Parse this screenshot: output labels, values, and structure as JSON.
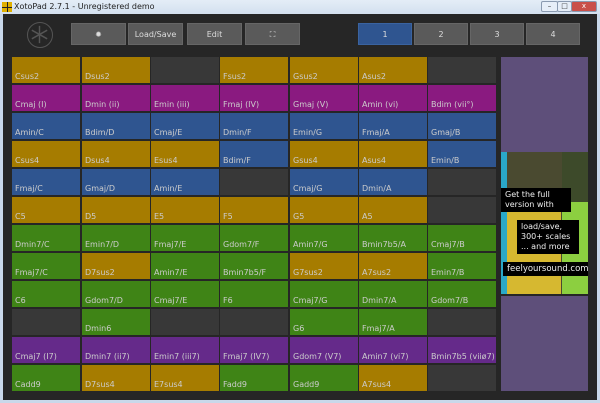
{
  "window": {
    "title": "XotoPad 2.7.1 - Unregistered demo"
  },
  "toolbar": {
    "settings_icon": "gear-icon",
    "load_save": "Load/Save",
    "edit": "Edit",
    "fullscreen_icon": "fullscreen-icon"
  },
  "pages": {
    "items": [
      "1",
      "2",
      "3",
      "4"
    ],
    "active": "1"
  },
  "colors": {
    "Y": "#a67c00",
    "M": "#8a1a80",
    "B": "#2f5590",
    "G": "#3f8416",
    "P": "#652a8a",
    "E": "#383838"
  },
  "grid": [
    [
      [
        "Csus2",
        "Y"
      ],
      [
        "Dsus2",
        "Y"
      ],
      [
        "",
        "E"
      ],
      [
        "Fsus2",
        "Y"
      ],
      [
        "Gsus2",
        "Y"
      ],
      [
        "Asus2",
        "Y"
      ],
      [
        "",
        "E"
      ]
    ],
    [
      [
        "Cmaj (I)",
        "M"
      ],
      [
        "Dmin (ii)",
        "M"
      ],
      [
        "Emin (iii)",
        "M"
      ],
      [
        "Fmaj (IV)",
        "M"
      ],
      [
        "Gmaj (V)",
        "M"
      ],
      [
        "Amin (vi)",
        "M"
      ],
      [
        "Bdim (vii°)",
        "M"
      ]
    ],
    [
      [
        "Amin/C",
        "B"
      ],
      [
        "Bdim/D",
        "B"
      ],
      [
        "Cmaj/E",
        "B"
      ],
      [
        "Dmin/F",
        "B"
      ],
      [
        "Emin/G",
        "B"
      ],
      [
        "Fmaj/A",
        "B"
      ],
      [
        "Gmaj/B",
        "B"
      ]
    ],
    [
      [
        "Csus4",
        "Y"
      ],
      [
        "Dsus4",
        "Y"
      ],
      [
        "Esus4",
        "Y"
      ],
      [
        "Bdim/F",
        "B"
      ],
      [
        "Gsus4",
        "Y"
      ],
      [
        "Asus4",
        "Y"
      ],
      [
        "Emin/B",
        "B"
      ]
    ],
    [
      [
        "Fmaj/C",
        "B"
      ],
      [
        "Gmaj/D",
        "B"
      ],
      [
        "Amin/E",
        "B"
      ],
      [
        "",
        "E"
      ],
      [
        "Cmaj/G",
        "B"
      ],
      [
        "Dmin/A",
        "B"
      ],
      [
        "",
        "E"
      ]
    ],
    [
      [
        "C5",
        "Y"
      ],
      [
        "D5",
        "Y"
      ],
      [
        "E5",
        "Y"
      ],
      [
        "F5",
        "Y"
      ],
      [
        "G5",
        "Y"
      ],
      [
        "A5",
        "Y"
      ],
      [
        "",
        "E"
      ]
    ],
    [
      [
        "Dmin7/C",
        "G"
      ],
      [
        "Emin7/D",
        "G"
      ],
      [
        "Fmaj7/E",
        "G"
      ],
      [
        "Gdom7/F",
        "G"
      ],
      [
        "Amin7/G",
        "G"
      ],
      [
        "Bmin7b5/A",
        "G"
      ],
      [
        "Cmaj7/B",
        "G"
      ]
    ],
    [
      [
        "Fmaj7/C",
        "G"
      ],
      [
        "D7sus2",
        "Y"
      ],
      [
        "Amin7/E",
        "G"
      ],
      [
        "Bmin7b5/F",
        "G"
      ],
      [
        "G7sus2",
        "Y"
      ],
      [
        "A7sus2",
        "Y"
      ],
      [
        "Emin7/B",
        "G"
      ]
    ],
    [
      [
        "C6",
        "G"
      ],
      [
        "Gdom7/D",
        "G"
      ],
      [
        "Cmaj7/E",
        "G"
      ],
      [
        "F6",
        "G"
      ],
      [
        "Cmaj7/G",
        "G"
      ],
      [
        "Dmin7/A",
        "G"
      ],
      [
        "Gdom7/B",
        "G"
      ]
    ],
    [
      [
        "",
        "E"
      ],
      [
        "Dmin6",
        "G"
      ],
      [
        "",
        "E"
      ],
      [
        "",
        "E"
      ],
      [
        "G6",
        "G"
      ],
      [
        "Fmaj7/A",
        "G"
      ],
      [
        "",
        "E"
      ]
    ],
    [
      [
        "Cmaj7 (I7)",
        "P"
      ],
      [
        "Dmin7 (ii7)",
        "P"
      ],
      [
        "Emin7 (iii7)",
        "P"
      ],
      [
        "Fmaj7 (IV7)",
        "P"
      ],
      [
        "Gdom7 (V7)",
        "P"
      ],
      [
        "Amin7 (vi7)",
        "P"
      ],
      [
        "Bmin7b5 (viiø7)",
        "P"
      ]
    ],
    [
      [
        "Cadd9",
        "G"
      ],
      [
        "D7sus4",
        "Y"
      ],
      [
        "E7sus4",
        "Y"
      ],
      [
        "Fadd9",
        "G"
      ],
      [
        "Gadd9",
        "G"
      ],
      [
        "A7sus4",
        "Y"
      ],
      [
        "",
        "E"
      ]
    ]
  ],
  "ad": {
    "line1": "Get the full version with",
    "line2": "load/save, 300+ scales ... and more",
    "url": "feelyoursound.com"
  }
}
